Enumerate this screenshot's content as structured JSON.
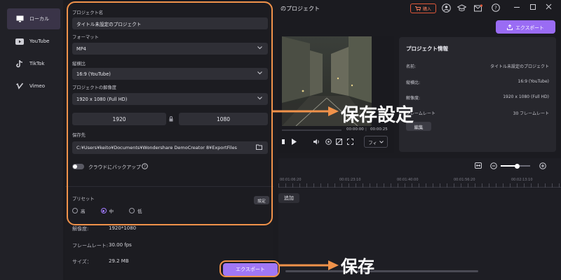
{
  "window_title": "のプロジェクト",
  "sidebar": {
    "items": [
      {
        "label": "ローカル",
        "icon": "monitor-icon",
        "active": true
      },
      {
        "label": "YouTube",
        "icon": "youtube-icon",
        "active": false
      },
      {
        "label": "TikTok",
        "icon": "tiktok-icon",
        "active": false
      },
      {
        "label": "Vimeo",
        "icon": "vimeo-icon",
        "active": false
      }
    ]
  },
  "topbar": {
    "buy_label": "購入",
    "export_label": "エクスポート"
  },
  "settings": {
    "name_label": "プロジェクト名",
    "name_value": "タイトル未設定のプロジェクト",
    "format_label": "フォーマット",
    "format_value": "MP4",
    "aspect_label": "縦横比",
    "aspect_value": "16:9 (YouTube)",
    "resolution_label": "プロジェクトの解像度",
    "resolution_value": "1920 x 1080 (Full HD)",
    "width": "1920",
    "height": "1080",
    "save_to_label": "保存先",
    "save_to_value": "C:¥Users¥keito¥Documents¥Wondershare DemoCreator 8¥ExportFiles",
    "cloud_backup_label": "クラウドにバックアップ",
    "preset_label": "プリセット",
    "preset_settings_label": "設定",
    "preset_options": [
      "高",
      "中",
      "低"
    ],
    "preset_selected": "中"
  },
  "summary": {
    "resolution_label": "解像度:",
    "resolution_value": "1920*1080",
    "framerate_label": "フレームレート:",
    "framerate_value": "30.00 fps",
    "size_label": "サイズ：",
    "size_value": "29.2 MB"
  },
  "export_button_label": "エクスポート",
  "player": {
    "time_current": "00:00:00",
    "time_total": "00:00:25",
    "fit_label": "フィ"
  },
  "project_info": {
    "title": "プロジェクト情報",
    "rows": [
      {
        "label": "名前:",
        "value": "タイトル未設定のプロジェクト"
      },
      {
        "label": "縦横比:",
        "value": "16:9 (YouTube)"
      },
      {
        "label": "解像度:",
        "value": "1920 x 1080 (Full HD)"
      },
      {
        "label": "フレームレート",
        "value": "30 フレームレート"
      }
    ],
    "edit_label": "編集"
  },
  "timeline": {
    "ticks": [
      "00:01:06:20",
      "00:01:23:10",
      "00:01:40:00",
      "00:01:56:20",
      "00:02:13:10"
    ],
    "add_label": "追加"
  },
  "annotations": {
    "settings_callout": "保存設定",
    "save_callout": "保存"
  },
  "colors": {
    "accent": "#8a5cf6",
    "highlight": "#f0924a"
  }
}
